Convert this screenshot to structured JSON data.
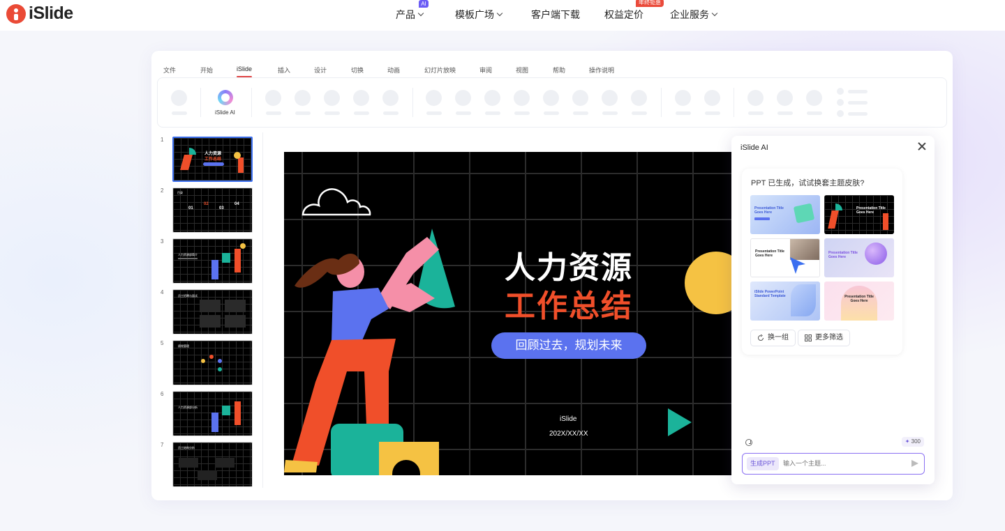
{
  "nav": {
    "logo": "iSlide",
    "items": [
      {
        "label": "产品",
        "badge": "AI"
      },
      {
        "label": "模板广场"
      },
      {
        "label": "客户端下载"
      },
      {
        "label": "权益定价",
        "badge": "年终钜惠"
      },
      {
        "label": "企业服务"
      }
    ]
  },
  "ribbon": {
    "tabs": [
      "文件",
      "开始",
      "iSlide",
      "插入",
      "设计",
      "切换",
      "动画",
      "幻灯片放映",
      "审阅",
      "视图",
      "帮助",
      "操作说明"
    ],
    "active_tab": "iSlide",
    "ai_button": "iSlide AI"
  },
  "thumbnails": [
    {
      "num": "1",
      "title1": "人力资源",
      "title2": "工作总结"
    },
    {
      "num": "2",
      "title": "目录",
      "items": [
        "01",
        "02",
        "03",
        "04"
      ]
    },
    {
      "num": "3",
      "title": "人力资源部简介"
    },
    {
      "num": "4",
      "title": "员工招聘与面试"
    },
    {
      "num": "5",
      "title": "绩效管理"
    },
    {
      "num": "6",
      "title": "人力资源部分析"
    },
    {
      "num": "7",
      "title": "员工结构分析"
    }
  ],
  "slide": {
    "title_line1": "人力资源",
    "title_line2": "工作总结",
    "subtitle": "回顾过去，规划未来",
    "brand": "iSlide",
    "date": "202X/XX/XX"
  },
  "ai_panel": {
    "title": "iSlide AI",
    "prompt": "PPT 已生成，试试换套主题皮肤?",
    "themes": [
      {
        "title": "Presentation Title Goes Here"
      },
      {
        "title": "Presentation Title Goes Here"
      },
      {
        "title": "Presentation Title Goes Here"
      },
      {
        "title": "Presentation Title Goes Here"
      },
      {
        "title": "iSlide PowerPoint Standard Template"
      },
      {
        "title": "Presentation Title Goes Here"
      }
    ],
    "swap_button": "换一组",
    "filter_button": "更多筛选",
    "credits": "300",
    "generate_tag": "生成PPT",
    "input_placeholder": "输入一个主题..."
  },
  "colors": {
    "accent": "#5b72ef",
    "brand_red": "#ea4a36",
    "slide_orange": "#f04f2a",
    "teal": "#1bb39a",
    "yellow": "#f5c243"
  }
}
